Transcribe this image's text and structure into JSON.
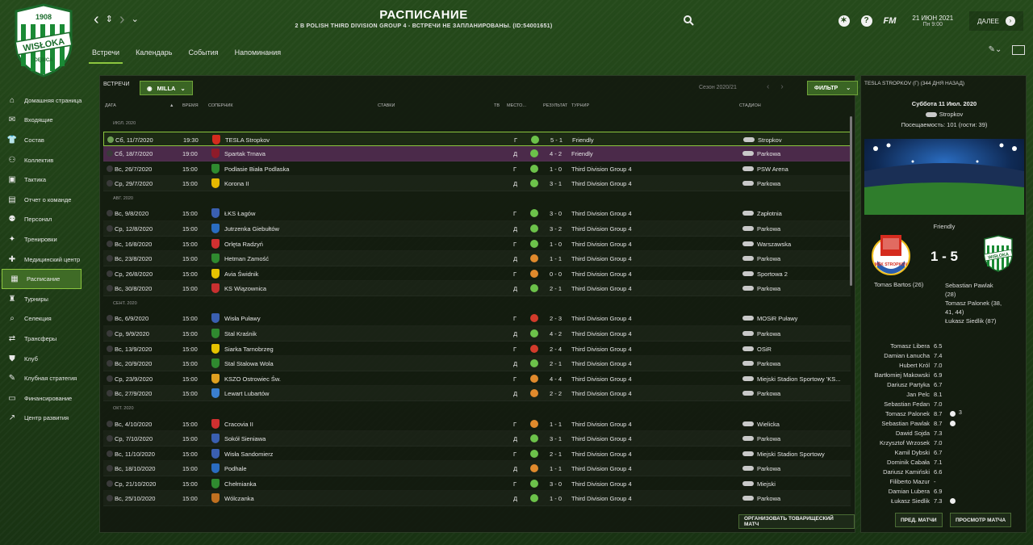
{
  "club": {
    "year": "1908",
    "name": "WISŁOKA",
    "city": "DĘBICA"
  },
  "header": {
    "title": "РАСПИСАНИЕ",
    "subtitle": "2 B POLISH THIRD DIVISION GROUP 4 - ВСТРЕЧИ НЕ ЗАПЛАНИРОВАНЫ. (ID:54001651)",
    "fm_label": "FM",
    "help_label": "?",
    "date": "21 ИЮН 2021",
    "day_time": "Пн 9:00",
    "next_label": "ДАЛЕЕ"
  },
  "tabs": [
    "Встречи",
    "Календарь",
    "События",
    "Напоминания"
  ],
  "sidebar": [
    {
      "label": "Домашняя страница",
      "icon": "home-icon",
      "glyph": "⌂"
    },
    {
      "label": "Входящие",
      "icon": "inbox-icon",
      "glyph": "✉"
    },
    {
      "label": "Состав",
      "icon": "squad-icon",
      "glyph": "👕"
    },
    {
      "label": "Коллектив",
      "icon": "staff-icon",
      "glyph": "⚇"
    },
    {
      "label": "Тактика",
      "icon": "tactics-icon",
      "glyph": "▣"
    },
    {
      "label": "Отчет о команде",
      "icon": "report-icon",
      "glyph": "▤"
    },
    {
      "label": "Персонал",
      "icon": "personnel-icon",
      "glyph": "⚉"
    },
    {
      "label": "Тренировки",
      "icon": "training-icon",
      "glyph": "✦"
    },
    {
      "label": "Медицинский центр",
      "icon": "medical-icon",
      "glyph": "✚"
    },
    {
      "label": "Расписание",
      "icon": "calendar-icon",
      "glyph": "▦"
    },
    {
      "label": "Турниры",
      "icon": "trophy-icon",
      "glyph": "♜"
    },
    {
      "label": "Селекция",
      "icon": "scouting-icon",
      "glyph": "⌕"
    },
    {
      "label": "Трансферы",
      "icon": "transfers-icon",
      "glyph": "⇄"
    },
    {
      "label": "Клуб",
      "icon": "club-icon",
      "glyph": "⛊"
    },
    {
      "label": "Клубная стратегия",
      "icon": "strategy-icon",
      "glyph": "✎"
    },
    {
      "label": "Финансирование",
      "icon": "finances-icon",
      "glyph": "▭"
    },
    {
      "label": "Центр развития",
      "icon": "development-icon",
      "glyph": "↗"
    }
  ],
  "filters": {
    "matches_label": "ВСТРЕЧИ",
    "team_value": "MILLA",
    "season": "Сезон 2020/21",
    "filter_label": "ФИЛЬТР"
  },
  "columns": {
    "date": "ДАТА",
    "time": "ВРЕМЯ",
    "opponent": "СОПЕРНИК",
    "odds": "СТАВКИ",
    "tv": "ТВ",
    "place": "МЕСТО...",
    "result": "РЕЗУЛЬТАТ",
    "competition": "ТУРНИР",
    "stadium": "СТАДИОН"
  },
  "colors": {
    "accent": "#8cc63f",
    "win": "#6cc24a",
    "draw": "#e08a2c",
    "loss": "#d23b2b"
  },
  "months": [
    {
      "label": "ИЮЛ. 2020",
      "matches": [
        {
          "date": "Сб, 11/7/2020",
          "time": "19:30",
          "opponent": "TESLA Stropkov",
          "place": "Г",
          "outcome": "win",
          "result": "5 - 1",
          "competition": "Friendly",
          "stadium": "Stropkov",
          "crest": "#d52b1e"
        },
        {
          "date": "Сб, 18/7/2020",
          "time": "19:00",
          "opponent": "Spartak Trnava",
          "place": "Д",
          "outcome": "win",
          "result": "4 - 2",
          "competition": "Friendly",
          "stadium": "Parkowa",
          "crest": "#8e1b2a"
        },
        {
          "date": "Вс, 26/7/2020",
          "time": "15:00",
          "opponent": "Podlasie Biała Podlaska",
          "place": "Г",
          "outcome": "win",
          "result": "1 - 0",
          "competition": "Third Division Group 4",
          "stadium": "PSW Arena",
          "crest": "#2f8a2f"
        },
        {
          "date": "Ср, 29/7/2020",
          "time": "15:00",
          "opponent": "Korona II",
          "place": "Д",
          "outcome": "win",
          "result": "3 - 1",
          "competition": "Third Division Group 4",
          "stadium": "Parkowa",
          "crest": "#e6b800"
        }
      ]
    },
    {
      "label": "АВГ. 2020",
      "matches": [
        {
          "date": "Вс, 9/8/2020",
          "time": "15:00",
          "opponent": "ŁKS Łagów",
          "place": "Г",
          "outcome": "win",
          "result": "3 - 0",
          "competition": "Third Division Group 4",
          "stadium": "Zapłotnia",
          "crest": "#3a5fb0"
        },
        {
          "date": "Ср, 12/8/2020",
          "time": "15:00",
          "opponent": "Jutrzenka Giebułtów",
          "place": "Д",
          "outcome": "win",
          "result": "3 - 2",
          "competition": "Third Division Group 4",
          "stadium": "Parkowa",
          "crest": "#2a6cc0"
        },
        {
          "date": "Вс, 16/8/2020",
          "time": "15:00",
          "opponent": "Orlęta Radzyń",
          "place": "Г",
          "outcome": "win",
          "result": "1 - 0",
          "competition": "Third Division Group 4",
          "stadium": "Warszawska",
          "crest": "#d03030"
        },
        {
          "date": "Вс, 23/8/2020",
          "time": "15:00",
          "opponent": "Hetman Zamość",
          "place": "Д",
          "outcome": "draw",
          "result": "1 - 1",
          "competition": "Third Division Group 4",
          "stadium": "Parkowa",
          "crest": "#2f8a2f"
        },
        {
          "date": "Ср, 26/8/2020",
          "time": "15:00",
          "opponent": "Avia Świdnik",
          "place": "Г",
          "outcome": "draw",
          "result": "0 - 0",
          "competition": "Third Division Group 4",
          "stadium": "Sportowa 2",
          "crest": "#e6c200"
        },
        {
          "date": "Вс, 30/8/2020",
          "time": "15:00",
          "opponent": "KS Wiązownica",
          "place": "Д",
          "outcome": "win",
          "result": "2 - 1",
          "competition": "Third Division Group 4",
          "stadium": "Parkowa",
          "crest": "#c83030"
        }
      ]
    },
    {
      "label": "СЕНТ. 2020",
      "matches": [
        {
          "date": "Вс, 6/9/2020",
          "time": "15:00",
          "opponent": "Wisła Puławy",
          "place": "Г",
          "outcome": "loss",
          "result": "2 - 3",
          "competition": "Third Division Group 4",
          "stadium": "MOSiR Puławy",
          "crest": "#3a5fb0"
        },
        {
          "date": "Ср, 9/9/2020",
          "time": "15:00",
          "opponent": "Stal Kraśnik",
          "place": "Д",
          "outcome": "win",
          "result": "4 - 2",
          "competition": "Third Division Group 4",
          "stadium": "Parkowa",
          "crest": "#2f8a2f"
        },
        {
          "date": "Вс, 13/9/2020",
          "time": "15:00",
          "opponent": "Siarka Tarnobrzeg",
          "place": "Г",
          "outcome": "loss",
          "result": "2 - 4",
          "competition": "Third Division Group 4",
          "stadium": "OSiR",
          "crest": "#e6c200"
        },
        {
          "date": "Вс, 20/9/2020",
          "time": "15:00",
          "opponent": "Stal Stalowa Wola",
          "place": "Д",
          "outcome": "win",
          "result": "2 - 1",
          "competition": "Third Division Group 4",
          "stadium": "Parkowa",
          "crest": "#2f8a2f"
        },
        {
          "date": "Ср, 23/9/2020",
          "time": "15:00",
          "opponent": "KSZO Ostrowiec Św.",
          "place": "Г",
          "outcome": "draw",
          "result": "4 - 4",
          "competition": "Third Division Group 4",
          "stadium": "Miejski Stadion Sportowy 'KS...",
          "crest": "#e0a020"
        },
        {
          "date": "Вс, 27/9/2020",
          "time": "15:00",
          "opponent": "Lewart Lubartów",
          "place": "Д",
          "outcome": "draw",
          "result": "2 - 2",
          "competition": "Third Division Group 4",
          "stadium": "Parkowa",
          "crest": "#3a7fd0"
        }
      ]
    },
    {
      "label": "ОКТ. 2020",
      "matches": [
        {
          "date": "Вс, 4/10/2020",
          "time": "15:00",
          "opponent": "Cracovia II",
          "place": "Г",
          "outcome": "draw",
          "result": "1 - 1",
          "competition": "Third Division Group 4",
          "stadium": "Wielicka",
          "crest": "#d03030"
        },
        {
          "date": "Ср, 7/10/2020",
          "time": "15:00",
          "opponent": "Sokół Sieniawa",
          "place": "Д",
          "outcome": "win",
          "result": "3 - 1",
          "competition": "Third Division Group 4",
          "stadium": "Parkowa",
          "crest": "#3a5fb0"
        },
        {
          "date": "Вс, 11/10/2020",
          "time": "15:00",
          "opponent": "Wisła Sandomierz",
          "place": "Г",
          "outcome": "win",
          "result": "2 - 1",
          "competition": "Third Division Group 4",
          "stadium": "Miejski Stadion Sportowy",
          "crest": "#3a5fb0"
        },
        {
          "date": "Вс, 18/10/2020",
          "time": "15:00",
          "opponent": "Podhale",
          "place": "Д",
          "outcome": "draw",
          "result": "1 - 1",
          "competition": "Third Division Group 4",
          "stadium": "Parkowa",
          "crest": "#2a6cc0"
        },
        {
          "date": "Ср, 21/10/2020",
          "time": "15:00",
          "opponent": "Chełmianka",
          "place": "Г",
          "outcome": "win",
          "result": "3 - 0",
          "competition": "Third Division Group 4",
          "stadium": "Miejski",
          "crest": "#2f8a2f"
        },
        {
          "date": "Вс, 25/10/2020",
          "time": "15:00",
          "opponent": "Wólczanka",
          "place": "Д",
          "outcome": "win",
          "result": "1 - 0",
          "competition": "Third Division Group 4",
          "stadium": "Parkowa",
          "crest": "#c07020"
        }
      ]
    }
  ],
  "buttons": {
    "arrange_friendly": "ОРГАНИЗОВАТЬ ТОВАРИЩЕСКИЙ МАТЧ"
  },
  "match_detail": {
    "heading": "TESLA STROPKOV (Г) (344 ДНЯ НАЗАД)",
    "date": "Суббота 11 Июл. 2020",
    "stadium": "Stropkov",
    "attendance": "Посещаемость: 101 (гости: 39)",
    "competition": "Friendly",
    "score": "1 - 5",
    "home_crest_text": "MŠK\nSTROPKOV",
    "home_scorers": "Tomas Bartos (26)",
    "away_scorers": [
      "Sebastian Pawlak",
      "(28)",
      "Tomasz Palonek (38,",
      "41, 44)",
      "Łukasz Siedlik (87)"
    ],
    "ratings": [
      {
        "name": "Tomasz Libera",
        "rating": "6.5",
        "goals": ""
      },
      {
        "name": "Damian Łanucha",
        "rating": "7.4",
        "goals": ""
      },
      {
        "name": "Hubert Król",
        "rating": "7.0",
        "goals": ""
      },
      {
        "name": "Bartłomiej Makowski",
        "rating": "6.9",
        "goals": ""
      },
      {
        "name": "Dariusz Partyka",
        "rating": "6.7",
        "goals": ""
      },
      {
        "name": "Jan Pelc",
        "rating": "8.1",
        "goals": ""
      },
      {
        "name": "Sebastian Fedan",
        "rating": "7.0",
        "goals": ""
      },
      {
        "name": "Tomasz Palonek",
        "rating": "8.7",
        "goals": "3"
      },
      {
        "name": "Sebastian Pawlak",
        "rating": "8.7",
        "goals": "1"
      },
      {
        "name": "Dawid Sojda",
        "rating": "7.3",
        "goals": ""
      },
      {
        "name": "Krzysztof Wrzosek",
        "rating": "7.0",
        "goals": ""
      },
      {
        "name": "Kamil Dybski",
        "rating": "6.7",
        "goals": ""
      },
      {
        "name": "Dominik Cabała",
        "rating": "7.1",
        "goals": ""
      },
      {
        "name": "Dariusz Kamiński",
        "rating": "6.6",
        "goals": ""
      },
      {
        "name": "Filiberto Mazur",
        "rating": "-",
        "goals": ""
      },
      {
        "name": "Damian Lubera",
        "rating": "6.9",
        "goals": ""
      },
      {
        "name": "Łukasz Siedlik",
        "rating": "7.3",
        "goals": "1"
      }
    ],
    "prev_button": "ПРЕД. МАТЧИ",
    "view_button": "ПРОСМОТР МАТЧА"
  }
}
